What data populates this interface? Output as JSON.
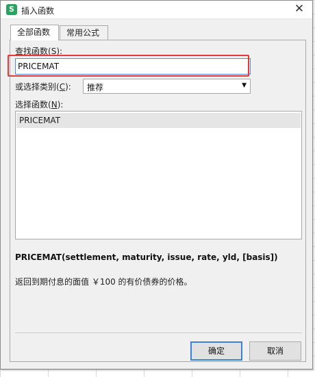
{
  "window": {
    "title": "插入函数",
    "app_icon_letter": "S",
    "close_glyph": "✕"
  },
  "tabs": [
    {
      "label": "全部函数",
      "active": true
    },
    {
      "label": "常用公式",
      "active": false
    }
  ],
  "search": {
    "label": "查找函数",
    "label_shortcut": "S",
    "value": "PRICEMAT"
  },
  "category": {
    "label": "或选择类别",
    "label_shortcut": "C",
    "selected": "推荐"
  },
  "functions": {
    "label": "选择函数",
    "label_shortcut": "N",
    "items": [
      "PRICEMAT"
    ]
  },
  "signature": "PRICEMAT(settlement, maturity, issue, rate, yld, [basis])",
  "description": "返回到期付息的面值 ￥100 的有价债券的价格。",
  "buttons": {
    "ok": "确定",
    "cancel": "取消"
  },
  "colors": {
    "highlight": "#e53935",
    "focus": "#3b82d6",
    "app_icon": "#2ba360"
  }
}
